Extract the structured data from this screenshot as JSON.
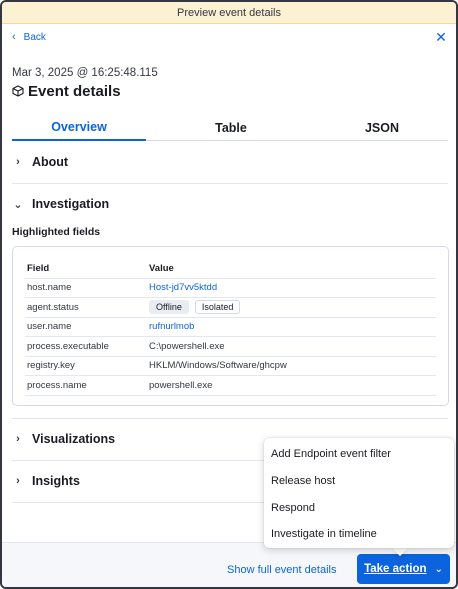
{
  "banner": {
    "text": "Preview event details"
  },
  "nav": {
    "back_label": "Back"
  },
  "header": {
    "timestamp": "Mar 3, 2025 @ 16:25:48.115",
    "title": "Event details"
  },
  "tabs": [
    {
      "label": "Overview",
      "active": true
    },
    {
      "label": "Table",
      "active": false
    },
    {
      "label": "JSON",
      "active": false
    }
  ],
  "sections": {
    "about": "About",
    "investigation": "Investigation",
    "visualizations": "Visualizations",
    "insights": "Insights"
  },
  "highlighted": {
    "label": "Highlighted fields",
    "col_field": "Field",
    "col_value": "Value",
    "rows": [
      {
        "field": "host.name",
        "value": "Host-jd7vv5ktdd"
      },
      {
        "field": "agent.status",
        "value": "Offline",
        "value2": "Isolated"
      },
      {
        "field": "user.name",
        "value": "rufnurlmob"
      },
      {
        "field": "process.executable",
        "value": "C:\\powershell.exe"
      },
      {
        "field": "registry.key",
        "value": "HKLM/Windows/Software/ghcpw"
      },
      {
        "field": "process.name",
        "value": "powershell.exe"
      }
    ]
  },
  "footer": {
    "show_full": "Show full event details",
    "take_action": "Take action"
  },
  "menu": {
    "items": [
      "Add Endpoint event filter",
      "Release host",
      "Respond",
      "Investigate in timeline"
    ]
  },
  "colors": {
    "accent": "#0b64dd",
    "banner_bg": "#fdf1d4",
    "footer_bg": "#f5f7fa"
  }
}
